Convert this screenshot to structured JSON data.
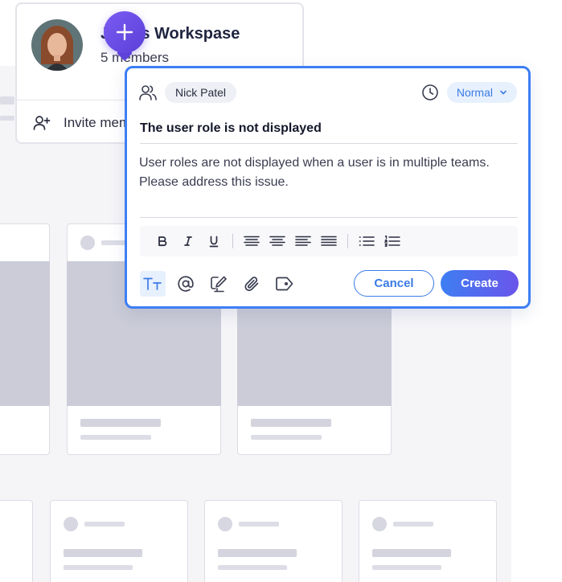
{
  "workspace": {
    "title": "Jane's Workspase",
    "members": "5 members",
    "invite_label": "Invite members"
  },
  "task": {
    "assignee": "Nick Patel",
    "priority": "Normal",
    "title": "The user role is not displayed",
    "description": "User roles are not displayed when a user is in multiple teams. Please address this issue."
  },
  "toolbar": {
    "format_icons": [
      "bold-icon",
      "italic-icon",
      "underline-icon",
      "align-left-icon",
      "align-center-icon",
      "align-right-icon",
      "align-justify-icon",
      "bullet-list-icon",
      "numbered-list-icon"
    ],
    "action_icons": [
      "text-format-icon",
      "mention-icon",
      "edit-note-icon",
      "attachment-icon",
      "tag-icon"
    ]
  },
  "buttons": {
    "cancel": "Cancel",
    "create": "Create"
  },
  "colors": {
    "accent": "#3b7be6",
    "badge": "#6a4ce8",
    "skeleton": "#cbccd8"
  }
}
